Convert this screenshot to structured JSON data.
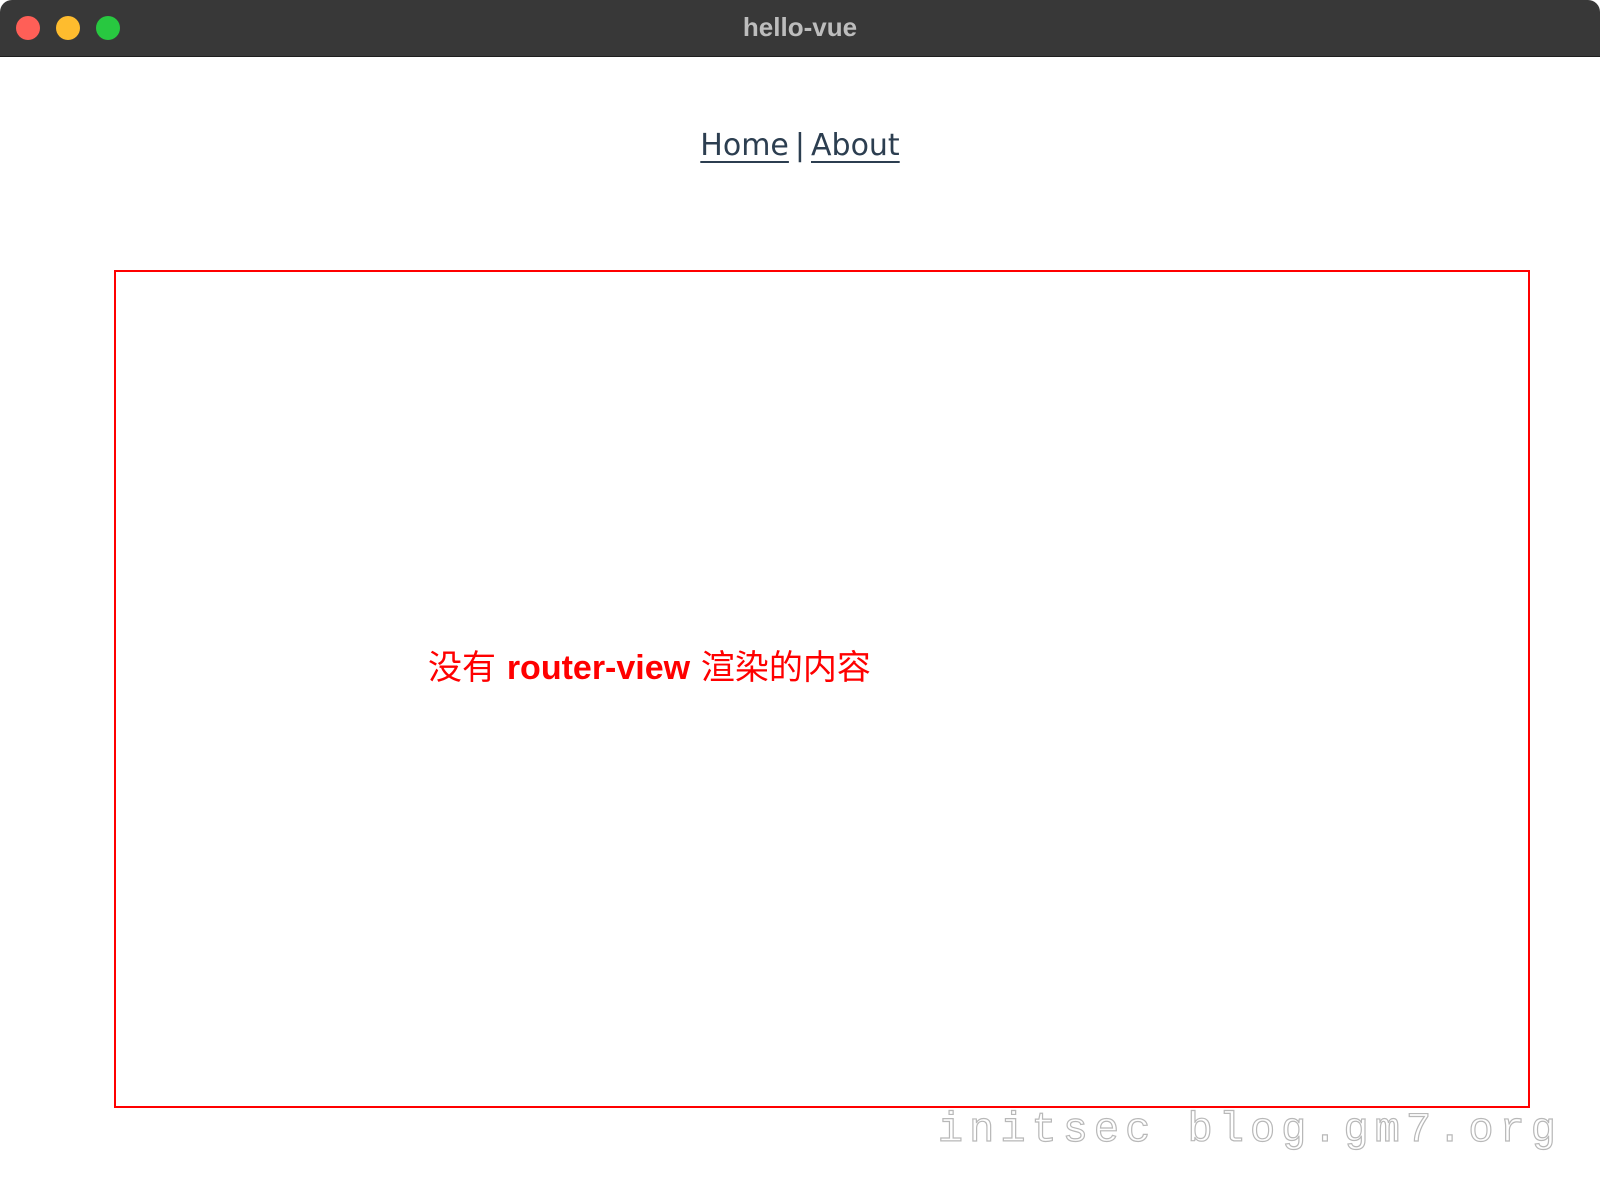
{
  "window": {
    "title": "hello-vue",
    "colors": {
      "close": "#ff5f57",
      "minimize": "#febc2e",
      "zoom": "#28c840"
    }
  },
  "nav": {
    "home_label": "Home",
    "separator": "|",
    "about_label": "About",
    "link_color": "#2c3e50"
  },
  "content": {
    "prefix": "没有 ",
    "highlight": "router-view",
    "suffix": " 渲染的内容",
    "accent_color": "#ff0000"
  },
  "watermark": {
    "text": "initsec blog.gm7.org"
  }
}
